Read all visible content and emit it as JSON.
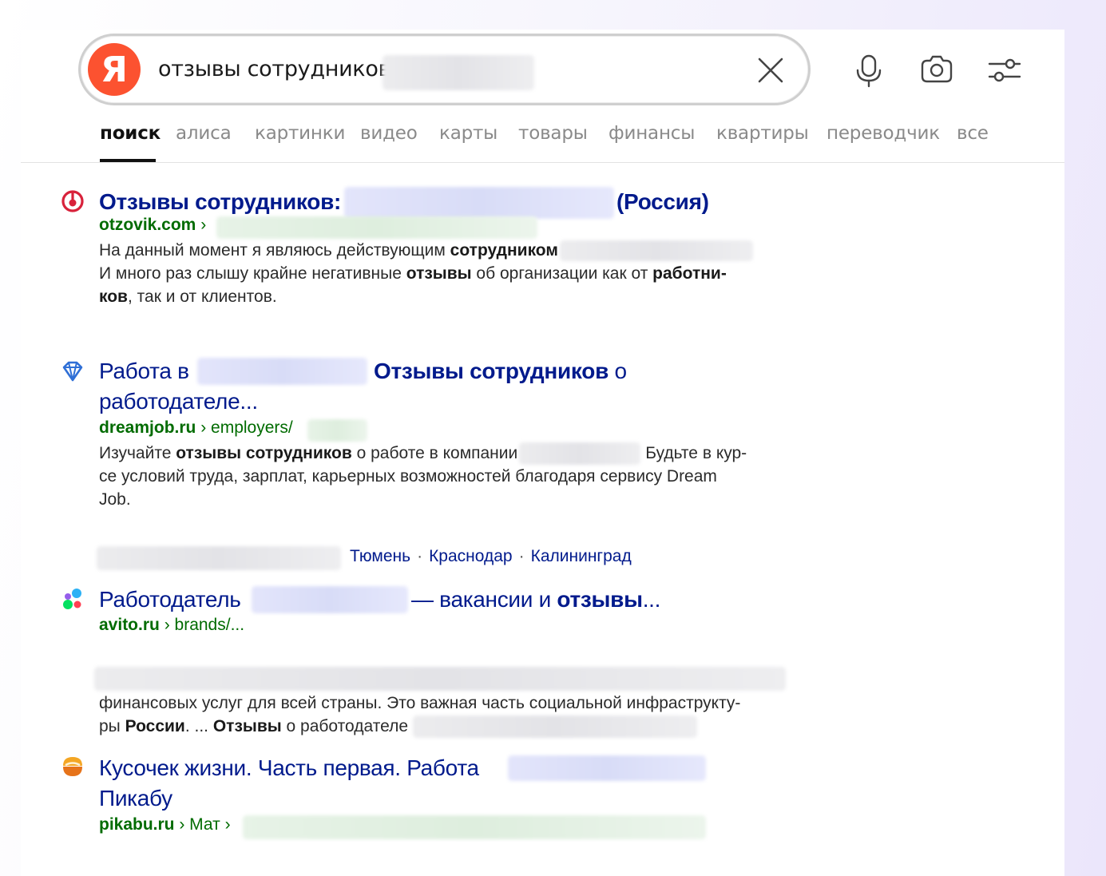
{
  "search": {
    "query": "отзывы сотрудников",
    "logo_letter": "Я"
  },
  "tabs": [
    {
      "label": "поиск",
      "active": true
    },
    {
      "label": "алиса"
    },
    {
      "label": "картинки"
    },
    {
      "label": "видео"
    },
    {
      "label": "карты"
    },
    {
      "label": "товары"
    },
    {
      "label": "финансы"
    },
    {
      "label": "квартиры"
    },
    {
      "label": "переводчик"
    },
    {
      "label": "все"
    }
  ],
  "results": [
    {
      "title_a": "Отзывы сотрудников:",
      "title_b": "(Россия)",
      "host": "otzovik.com",
      "path": " ›",
      "snippet": {
        "l1_a": "На данный момент я являюсь действующим ",
        "l1_b": "сотрудником",
        "l2_a": "И много раз слышу крайне негативные ",
        "l2_b": "отзывы",
        "l2_c": " об организации как от ",
        "l2_d": "работни-",
        "l3_a": "ков",
        "l3_b": ", так и от клиентов."
      }
    },
    {
      "title_a": "Работа в ",
      "title_b": "Отзывы сотрудников",
      "title_c": " о",
      "title_l2": "работодателе...",
      "host": "dreamjob.ru",
      "path": " › employers/",
      "snippet": {
        "l1_a": "Изучайте ",
        "l1_b": "отзывы сотрудников",
        "l1_c": " о работе в компании",
        "l1_d": "Будьте в кур-",
        "l2": "се условий труда, зарплат, карьерных возможностей благодаря сервису Dream",
        "l3": "Job."
      },
      "cities": [
        "Тюмень",
        "Краснодар",
        "Калининград"
      ]
    },
    {
      "title_a": "Работодатель",
      "title_b": "— вакансии и ",
      "title_c": "отзывы",
      "title_d": "...",
      "host": "avito.ru",
      "path": " › brands/...",
      "snippet": {
        "l2": "финансовых услуг для всей страны. Это важная часть социальной инфраструкту-",
        "l3_a": "ры ",
        "l3_b": "России",
        "l3_c": ". ... ",
        "l3_d": "Отзывы",
        "l3_e": " о работодателе"
      }
    },
    {
      "title_a": "Кусочек жизни. Часть первая. Работа",
      "title_l2": "Пикабу",
      "host": "pikabu.ru",
      "path": " › Мат ›"
    }
  ]
}
